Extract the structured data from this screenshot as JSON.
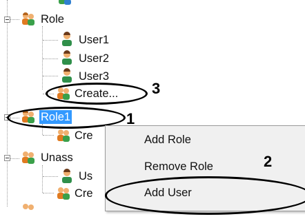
{
  "tree": {
    "nodes": [
      {
        "label": "Role"
      },
      {
        "label": "User1"
      },
      {
        "label": "User2"
      },
      {
        "label": "User3"
      },
      {
        "label": "Create..."
      },
      {
        "label": "Role1"
      },
      {
        "label": "Cre"
      },
      {
        "label": "Unass"
      },
      {
        "label": "Us"
      },
      {
        "label": "Cre"
      }
    ]
  },
  "context_menu": {
    "items": [
      {
        "label": "Add Role"
      },
      {
        "label": "Remove Role"
      },
      {
        "label": "Add User"
      }
    ]
  },
  "callouts": [
    "1",
    "2",
    "3"
  ],
  "colors": {
    "selection": "#3399ff",
    "menu_bg": "#f0f0f0"
  }
}
